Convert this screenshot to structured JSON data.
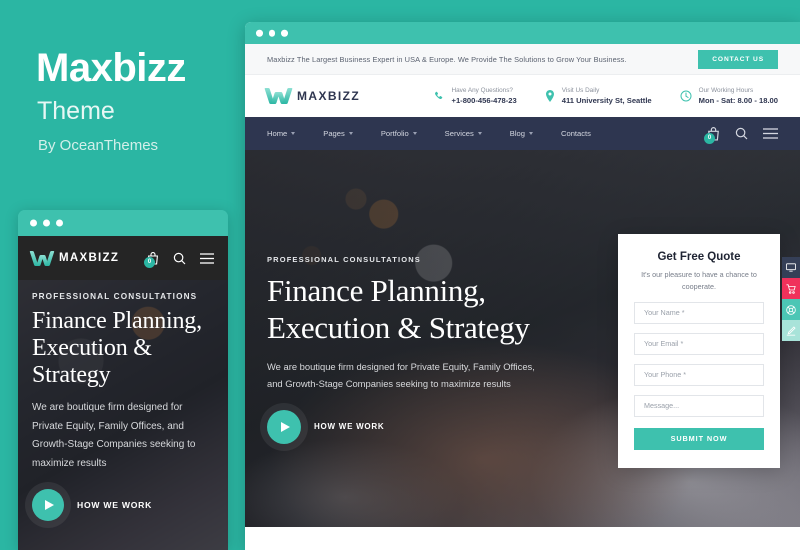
{
  "promo": {
    "title": "Maxbizz",
    "subtitle": "Theme",
    "byline": "By OceanThemes",
    "accent_color": "#2bb6a3"
  },
  "brand": {
    "name": "MAXBIZZ",
    "logo_icon": "maxbizz-m-logo",
    "primary_color": "#3ec1ae",
    "nav_color": "#2e3650"
  },
  "browser": {
    "window_dots": [
      "dot-red",
      "dot-yellow",
      "dot-green"
    ],
    "topbar": {
      "message": "Maxbizz The Largest Business Expert in USA & Europe. We Provide The Solutions to Grow Your Business.",
      "cta_label": "CONTACT US"
    },
    "header_info": [
      {
        "icon": "phone-icon",
        "label": "Have Any Questions?",
        "value": "+1-800-456-478-23"
      },
      {
        "icon": "map-pin-icon",
        "label": "Visit Us Daily",
        "value": "411 University St, Seattle"
      },
      {
        "icon": "clock-icon",
        "label": "Our Working Hours",
        "value": "Mon - Sat: 8.00 - 18.00"
      }
    ],
    "nav": {
      "items": [
        {
          "label": "Home",
          "has_dropdown": true
        },
        {
          "label": "Pages",
          "has_dropdown": true
        },
        {
          "label": "Portfolio",
          "has_dropdown": true
        },
        {
          "label": "Services",
          "has_dropdown": true
        },
        {
          "label": "Blog",
          "has_dropdown": true
        },
        {
          "label": "Contacts",
          "has_dropdown": false
        }
      ],
      "icons": [
        "cart-icon",
        "search-icon",
        "hamburger-menu-icon"
      ],
      "cart_count": "0"
    },
    "hero": {
      "eyebrow": "PROFESSIONAL CONSULTATIONS",
      "heading_line1": "Finance Planning,",
      "heading_line2": "Execution & Strategy",
      "paragraph": "We are boutique firm designed for Private Equity, Family Offices, and Growth-Stage Companies seeking to maximize results",
      "video_label": "HOW WE WORK",
      "play_icon": "play-icon"
    },
    "quote_form": {
      "title": "Get Free Quote",
      "subtitle": "It's our pleasure to have a chance to cooperate.",
      "fields": [
        {
          "name": "name",
          "placeholder": "Your Name *",
          "value": ""
        },
        {
          "name": "email",
          "placeholder": "Your Email *",
          "value": ""
        },
        {
          "name": "phone",
          "placeholder": "Your Phone *",
          "value": ""
        },
        {
          "name": "message",
          "placeholder": "Message...",
          "value": ""
        }
      ],
      "submit_label": "SUBMIT NOW"
    },
    "side_buttons": [
      {
        "icon": "monitor-icon",
        "color": "#353f57"
      },
      {
        "icon": "cart-icon",
        "color": "#f0315b"
      },
      {
        "icon": "lifebuoy-support-icon",
        "color": "#4cc6b5"
      },
      {
        "icon": "edit-pencil-icon",
        "color": "#a8e3d9"
      }
    ]
  },
  "mobile": {
    "window_dots": [
      "dot-1",
      "dot-2",
      "dot-3"
    ],
    "brand_name": "MAXBIZZ",
    "header_icons": [
      "cart-icon",
      "search-icon",
      "hamburger-menu-icon"
    ],
    "cart_count": "0",
    "hero": {
      "eyebrow": "PROFESSIONAL CONSULTATIONS",
      "heading_line1": "Finance Planning,",
      "heading_line2": "Execution &",
      "heading_line3": "Strategy",
      "paragraph": "We are boutique firm designed for Private Equity, Family Offices, and Growth-Stage Companies seeking to maximize results",
      "video_label": "HOW WE WORK",
      "play_icon": "play-icon"
    }
  }
}
